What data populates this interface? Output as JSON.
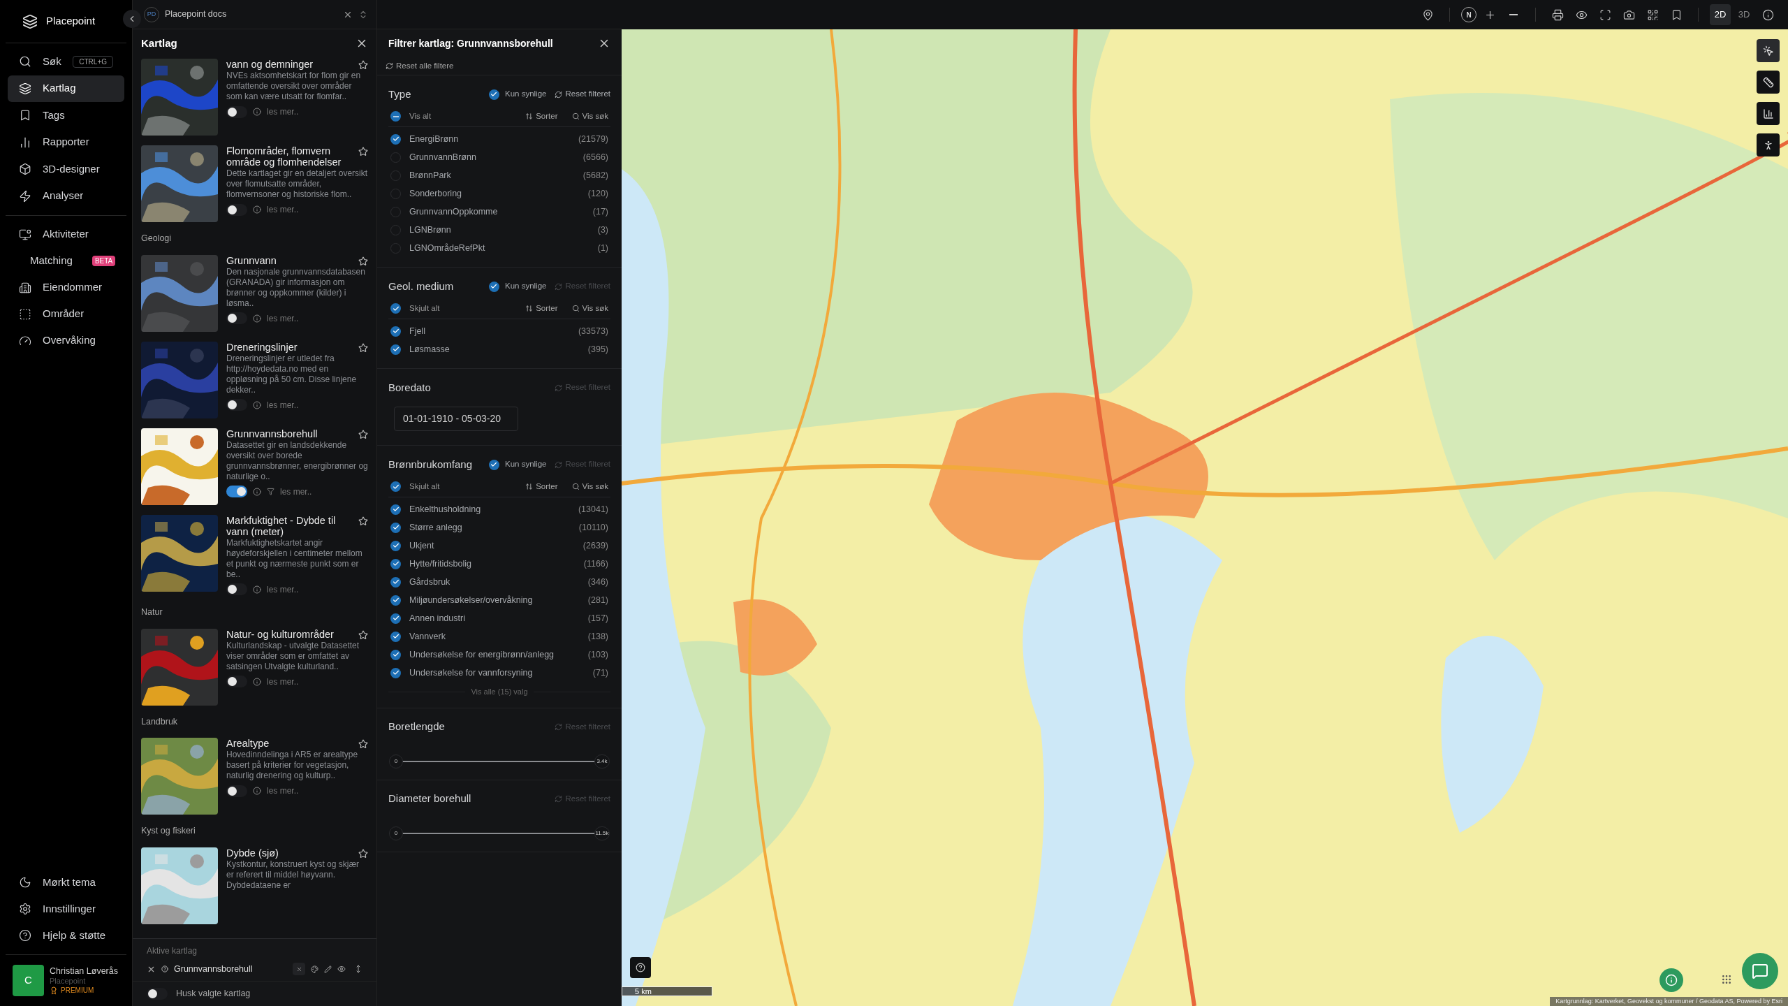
{
  "sidebar": {
    "brand": "Placepoint",
    "nav": [
      {
        "label": "Søk",
        "selected": false,
        "shortcut": "CTRL+G"
      },
      {
        "label": "Kartlag",
        "selected": true
      },
      {
        "label": "Tags",
        "selected": false
      },
      {
        "label": "Rapporter",
        "selected": false
      },
      {
        "label": "3D-designer",
        "selected": false
      },
      {
        "label": "Analyser",
        "selected": false
      }
    ],
    "nav2": [
      {
        "label": "Aktiviteter",
        "selected": false
      },
      {
        "label": "Matching",
        "selected": false,
        "badge": "BETA"
      },
      {
        "label": "Eiendommer",
        "selected": false
      },
      {
        "label": "Områder",
        "selected": false
      },
      {
        "label": "Overvåking",
        "selected": false
      }
    ],
    "bottom": [
      {
        "label": "Mørkt tema"
      },
      {
        "label": "Innstillinger"
      },
      {
        "label": "Hjelp & støtte"
      }
    ],
    "user": {
      "initial": "C",
      "name": "Christian Løverås",
      "org": "Placepoint",
      "plan": "PREMIUM"
    }
  },
  "workspace": {
    "initials": "PD",
    "name": "Placepoint docs"
  },
  "layers_panel": {
    "title": "Kartlag",
    "groups": [
      {
        "items": [
          {
            "title": "vann og demninger",
            "description": "NVEs aktsomhetskart for flom gir en omfattende oversikt over områder som kan være utsatt for flomfar..",
            "on": false,
            "more": "les mer.."
          },
          {
            "title": "Flomområder, flomvern område og flomhendelser",
            "description": "Dette kartlaget gir en detaljert oversikt over flomutsatte områder, flomvernsoner og historiske flom..",
            "on": false,
            "more": "les mer.."
          }
        ]
      },
      {
        "heading": "Geologi",
        "items": [
          {
            "title": "Grunnvann",
            "description": "Den nasjonale grunnvannsdatabasen (GRANADA) gir informasjon om brønner og oppkommer (kilder) i løsma..",
            "on": false,
            "more": "les mer.."
          },
          {
            "title": "Dreneringslinjer",
            "description": "Dreneringslinjer er utledet fra http://hoydedata.no med en oppløsning på 50 cm. Disse linjene dekker..",
            "on": false,
            "more": "les mer.."
          },
          {
            "title": "Grunnvannsborehull",
            "description": "Datasettet gir en landsdekkende oversikt over borede grunnvannsbrønner, energibrønner og naturlige o..",
            "on": true,
            "more": "les mer.."
          },
          {
            "title": "Markfuktighet - Dybde til vann (meter)",
            "description": "Markfuktighetskartet angir høydeforskjellen i centimeter mellom et punkt og nærmeste punkt som er be..",
            "on": false,
            "more": "les mer.."
          }
        ]
      },
      {
        "heading": "Natur",
        "items": [
          {
            "title": "Natur- og kulturområder",
            "description": "Kulturlandskap - utvalgte Datasettet viser områder som er omfattet av satsingen Utvalgte kulturland..",
            "on": false,
            "more": "les mer.."
          }
        ]
      },
      {
        "heading": "Landbruk",
        "items": [
          {
            "title": "Arealtype",
            "description": "Hovedinndelinga i AR5 er arealtype basert på kriterier for vegetasjon, naturlig drenering og kulturp..",
            "on": false,
            "more": "les mer.."
          }
        ]
      },
      {
        "heading": "Kyst og fiskeri",
        "items": [
          {
            "title": "Dybde (sjø)",
            "description": "Kystkontur, konstruert kyst og skjær er referert til middel høyvann. Dybdedataene er"
          }
        ]
      }
    ],
    "active": {
      "heading": "Aktive kartlag",
      "layers": [
        {
          "name": "Grunnvannsborehull"
        }
      ]
    },
    "remember": {
      "label": "Husk valgte kartlag",
      "on": false
    }
  },
  "filter_panel": {
    "title": "Filtrer kartlag: Grunnvannsborehull",
    "reset_all": "Reset alle filtere",
    "sections": [
      {
        "kind": "list",
        "title": "Type",
        "visible_only": {
          "label": "Kun synlige",
          "checked": true
        },
        "reset": {
          "label": "Reset filteret",
          "disabled": false
        },
        "toggle_all": {
          "label": "Vis alt",
          "indeterminate": true
        },
        "sort": "Sorter",
        "search": "Vis søk",
        "options": [
          {
            "label": "EnergiBrønn",
            "count": "(21579)",
            "checked": true
          },
          {
            "label": "GrunnvannBrønn",
            "count": "(6566)",
            "checked": false
          },
          {
            "label": "BrønnPark",
            "count": "(5682)",
            "checked": false
          },
          {
            "label": "Sonderboring",
            "count": "(120)",
            "checked": false
          },
          {
            "label": "GrunnvannOppkomme",
            "count": "(17)",
            "checked": false
          },
          {
            "label": "LGNBrønn",
            "count": "(3)",
            "checked": false
          },
          {
            "label": "LGNOmrådeRefPkt",
            "count": "(1)",
            "checked": false
          }
        ]
      },
      {
        "kind": "list",
        "title": "Geol. medium",
        "visible_only": {
          "label": "Kun synlige",
          "checked": true
        },
        "reset": {
          "label": "Reset filteret",
          "disabled": true
        },
        "toggle_all": {
          "label": "Skjult alt",
          "checked": true
        },
        "sort": "Sorter",
        "search": "Vis søk",
        "options": [
          {
            "label": "Fjell",
            "count": "(33573)",
            "checked": true
          },
          {
            "label": "Løsmasse",
            "count": "(395)",
            "checked": true
          }
        ]
      },
      {
        "kind": "date",
        "title": "Boredato",
        "reset": {
          "label": "Reset filteret",
          "disabled": true
        },
        "value": "01-01-1910 - 05-03-20"
      },
      {
        "kind": "list",
        "title": "Brønnbrukomfang",
        "visible_only": {
          "label": "Kun synlige",
          "checked": true
        },
        "reset": {
          "label": "Reset filteret",
          "disabled": true
        },
        "toggle_all": {
          "label": "Skjult alt",
          "checked": true
        },
        "sort": "Sorter",
        "search": "Vis søk",
        "options": [
          {
            "label": "Enkelthusholdning",
            "count": "(13041)",
            "checked": true
          },
          {
            "label": "Større anlegg",
            "count": "(10110)",
            "checked": true
          },
          {
            "label": "Ukjent",
            "count": "(2639)",
            "checked": true
          },
          {
            "label": "Hytte/fritidsbolig",
            "count": "(1166)",
            "checked": true
          },
          {
            "label": "Gårdsbruk",
            "count": "(346)",
            "checked": true
          },
          {
            "label": "Miljøundersøkelser/overvåkning",
            "count": "(281)",
            "checked": true
          },
          {
            "label": "Annen industri",
            "count": "(157)",
            "checked": true
          },
          {
            "label": "Vannverk",
            "count": "(138)",
            "checked": true
          },
          {
            "label": "Undersøkelse for energibrønn/anlegg",
            "count": "(103)",
            "checked": true
          },
          {
            "label": "Undersøkelse for vannforsyning",
            "count": "(71)",
            "checked": true
          }
        ],
        "show_all": "Vis alle (15) valg"
      },
      {
        "kind": "range",
        "title": "Boretlengde",
        "reset": {
          "label": "Reset filteret",
          "disabled": true
        },
        "min": "0",
        "max": "3.4k",
        "level": 1
      },
      {
        "kind": "range",
        "title": "Diameter borehull",
        "reset": {
          "label": "Reset filteret",
          "disabled": true
        },
        "min": "0",
        "max": "11.5k",
        "level": 1
      }
    ]
  },
  "map_toolbar": {
    "compass": "N",
    "view_modes": [
      {
        "label": "2D",
        "selected": true
      },
      {
        "label": "3D",
        "selected": false
      }
    ]
  },
  "map": {
    "scale": "5 km",
    "attribution": "Kartgrunnlag: Kartverket, Geovekst og kommuner / Geodata AS, Powered by Esri"
  }
}
